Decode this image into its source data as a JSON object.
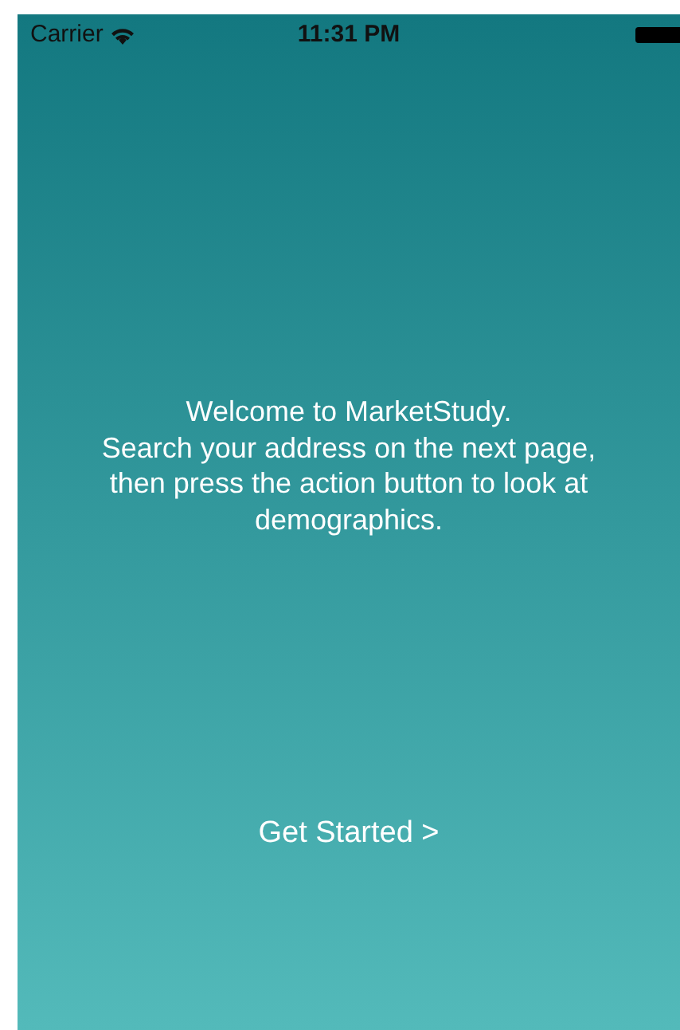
{
  "status_bar": {
    "carrier": "Carrier",
    "time": "11:31 PM"
  },
  "welcome": {
    "lines": [
      "Welcome to MarketStudy.",
      "Search your address on the next page, then press the action button to look at demographics."
    ]
  },
  "action": {
    "label": "Get Started >"
  }
}
